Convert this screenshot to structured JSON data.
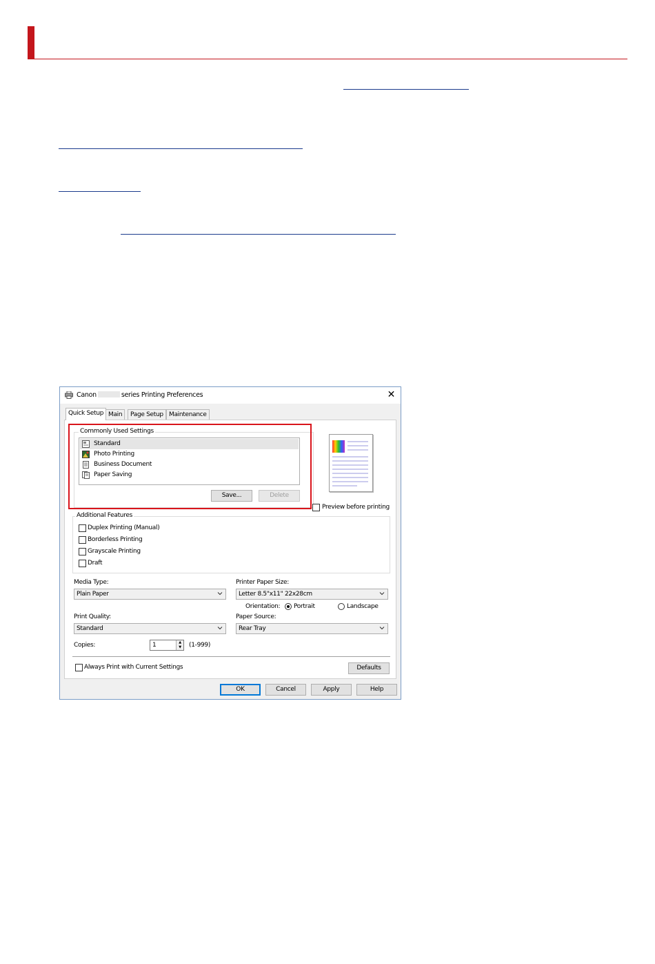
{
  "dialog": {
    "title_prefix": "Canon",
    "title_suffix": "series Printing Preferences",
    "close_glyph": "✕",
    "tabs": [
      "Quick Setup",
      "Main",
      "Page Setup",
      "Maintenance"
    ],
    "commonly_used": {
      "label": "Commonly Used Settings",
      "items": [
        "Standard",
        "Photo Printing",
        "Business Document",
        "Paper Saving"
      ],
      "selected": "Standard",
      "save_label": "Save...",
      "delete_label": "Delete"
    },
    "preview_label": "Preview before printing",
    "additional": {
      "label": "Additional Features",
      "items": [
        "Duplex Printing (Manual)",
        "Borderless Printing",
        "Grayscale Printing",
        "Draft"
      ]
    },
    "media_type": {
      "label": "Media Type:",
      "value": "Plain Paper"
    },
    "paper_size": {
      "label": "Printer Paper Size:",
      "value": "Letter 8.5\"x11\" 22x28cm"
    },
    "orientation": {
      "label": "Orientation:",
      "portrait": "Portrait",
      "landscape": "Landscape",
      "selected": "Portrait"
    },
    "print_quality": {
      "label": "Print Quality:",
      "value": "Standard"
    },
    "paper_source": {
      "label": "Paper Source:",
      "value": "Rear Tray"
    },
    "copies": {
      "label": "Copies:",
      "value": "1",
      "range": "(1-999)"
    },
    "always_print_label": "Always Print with Current Settings",
    "defaults_label": "Defaults",
    "buttons": {
      "ok": "OK",
      "cancel": "Cancel",
      "apply": "Apply",
      "help": "Help"
    }
  },
  "colors": {
    "highlight": "#d9141b",
    "heading_accent": "#c4161c",
    "link": "#1a3a8c"
  }
}
